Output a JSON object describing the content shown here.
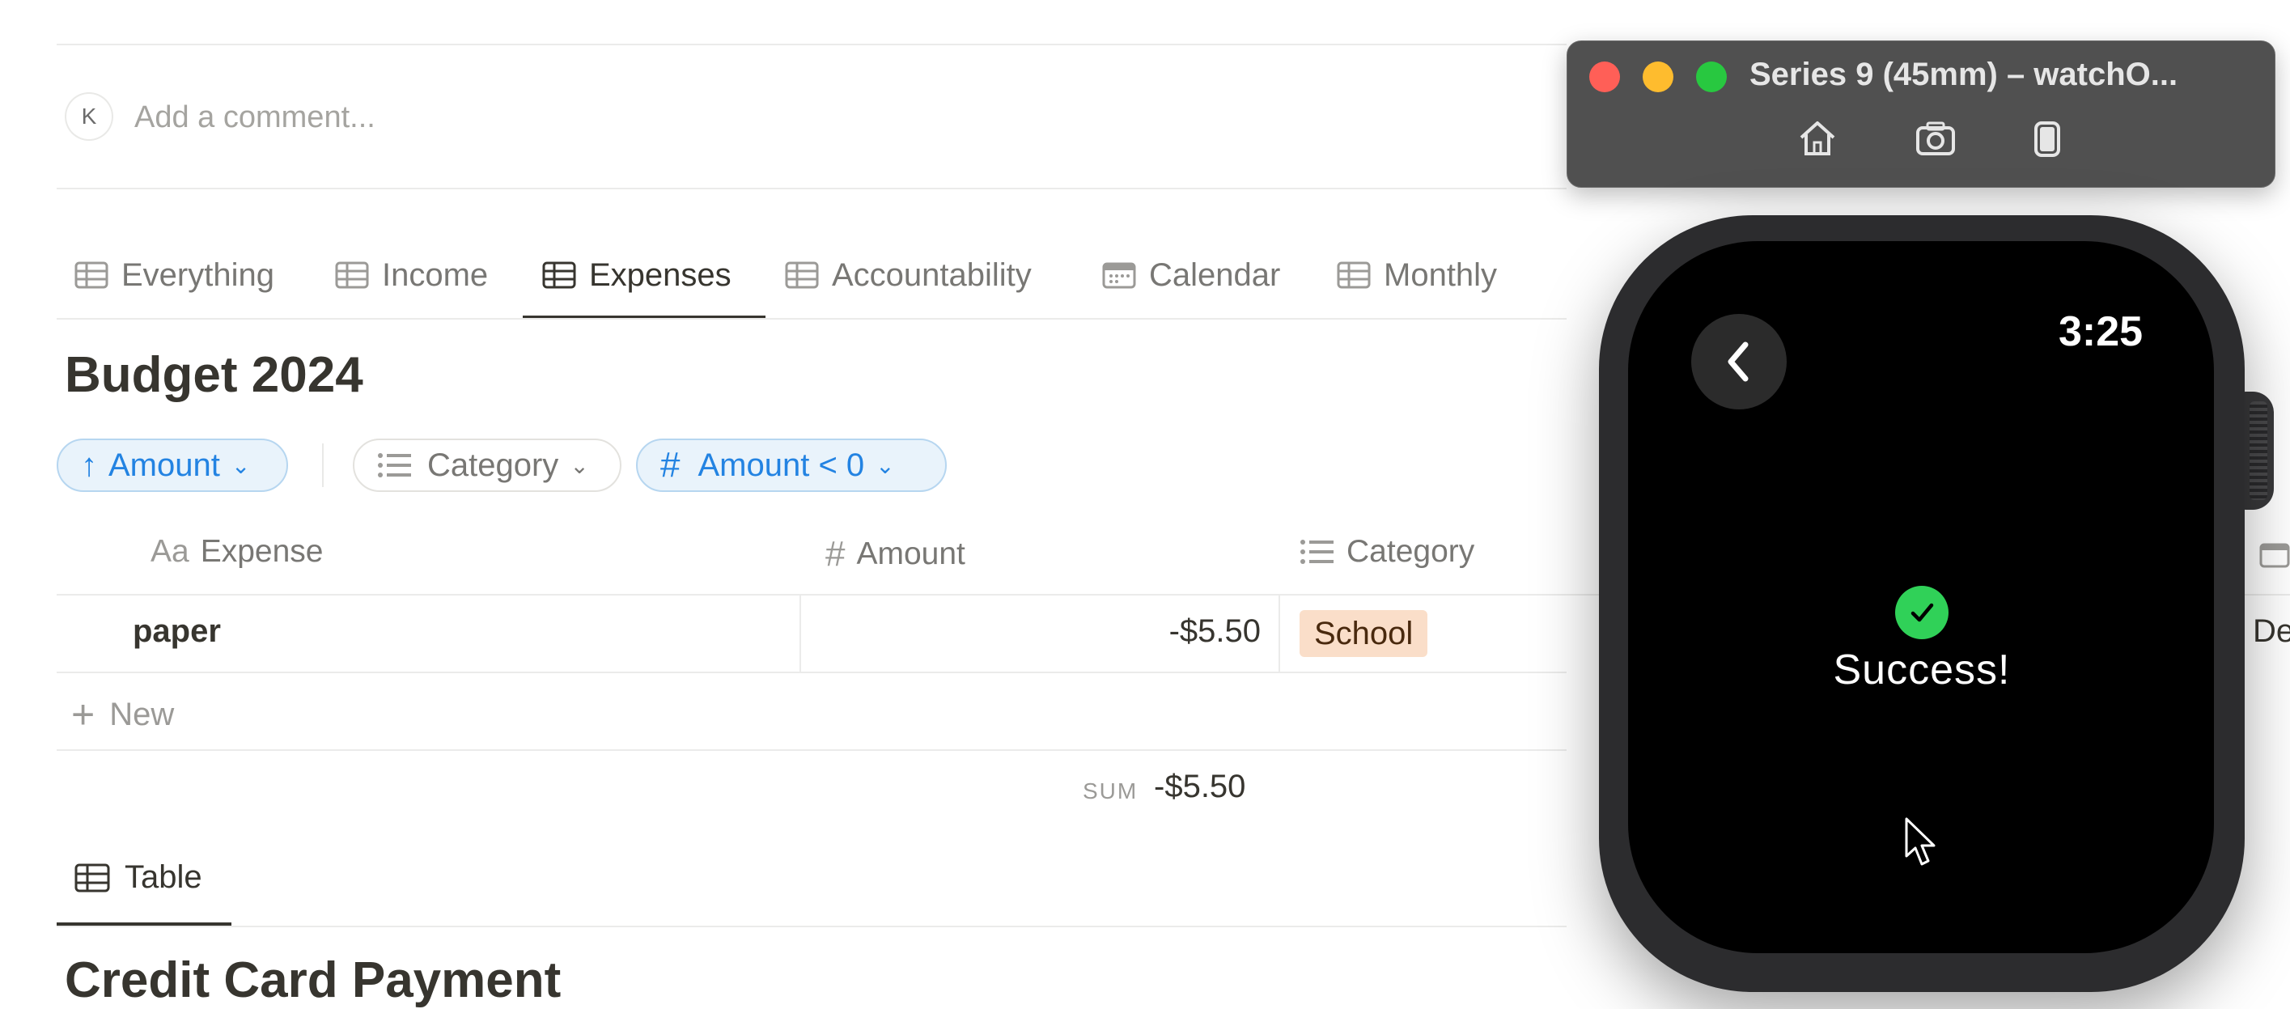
{
  "comment": {
    "avatar_initial": "K",
    "placeholder": "Add a comment..."
  },
  "tabs": [
    {
      "label": "Everything",
      "icon": "table-icon",
      "active": false
    },
    {
      "label": "Income",
      "icon": "table-icon",
      "active": false
    },
    {
      "label": "Expenses",
      "icon": "table-icon",
      "active": true
    },
    {
      "label": "Accountability",
      "icon": "table-icon",
      "active": false
    },
    {
      "label": "Calendar",
      "icon": "calendar-icon",
      "active": false
    },
    {
      "label": "Monthly",
      "icon": "table-icon",
      "active": false
    }
  ],
  "page_title": "Budget 2024",
  "filters": {
    "sort": {
      "label": "Amount",
      "icon": "arrow-up-icon"
    },
    "category": {
      "label": "Category",
      "icon": "list-icon"
    },
    "amount_filter": {
      "label": "Amount < 0",
      "icon": "hash-icon"
    }
  },
  "table": {
    "columns": [
      {
        "label": "Expense",
        "icon_text": "Aa"
      },
      {
        "label": "Amount",
        "icon_text": "#"
      },
      {
        "label": "Category",
        "icon": "list-icon"
      }
    ],
    "rows": [
      {
        "expense": "paper",
        "amount": "-$5.50",
        "category": "School",
        "partial_next": "De"
      }
    ],
    "new_label": "New",
    "sum_label": "SUM",
    "sum_value": "-$5.50"
  },
  "bottom_view": {
    "label": "Table",
    "icon": "table-icon"
  },
  "cut_heading": "Credit Card Payment",
  "simulator": {
    "title": "Series 9 (45mm) – watchO...",
    "buttons": [
      "home-icon",
      "screenshot-icon",
      "rotate-icon"
    ],
    "traffic_colors": {
      "close": "#ff5f57",
      "minimize": "#febc2e",
      "zoom": "#28c840"
    }
  },
  "watch": {
    "time": "3:25",
    "message": "Success!",
    "success_color": "#30d158"
  },
  "colors": {
    "accent_blue": "#2383e2",
    "tag_school_bg": "#fadec9"
  }
}
